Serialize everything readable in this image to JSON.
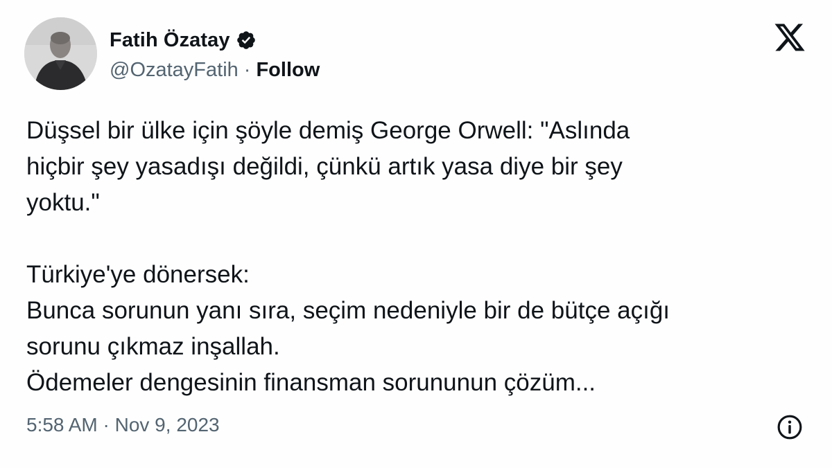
{
  "author": {
    "display_name": "Fatih Özatay",
    "handle": "@OzatayFatih",
    "separator": "·",
    "follow_label": "Follow",
    "verified_icon": "verified-badge-icon",
    "avatar_icon": "profile-photo"
  },
  "brand": {
    "logo_icon": "x-logo-icon"
  },
  "tweet": {
    "lines": [
      "Düşsel bir ülke için şöyle demiş George Orwell: \"Aslında",
      "hiçbir şey yasadışı değildi, çünkü artık yasa diye bir şey",
      "yoktu.\"",
      "",
      "Türkiye'ye dönersek:",
      "Bunca sorunun yanı sıra, seçim nedeniyle bir de bütçe açığı",
      "sorunu çıkmaz inşallah.",
      "Ödemeler dengesinin finansman sorununun çözüm..."
    ]
  },
  "footer": {
    "timestamp": "5:58 AM · Nov 9, 2023",
    "info_icon": "info-icon"
  },
  "colors": {
    "text_primary": "#0f1419",
    "text_secondary": "#536471",
    "background": "#fefefe"
  }
}
